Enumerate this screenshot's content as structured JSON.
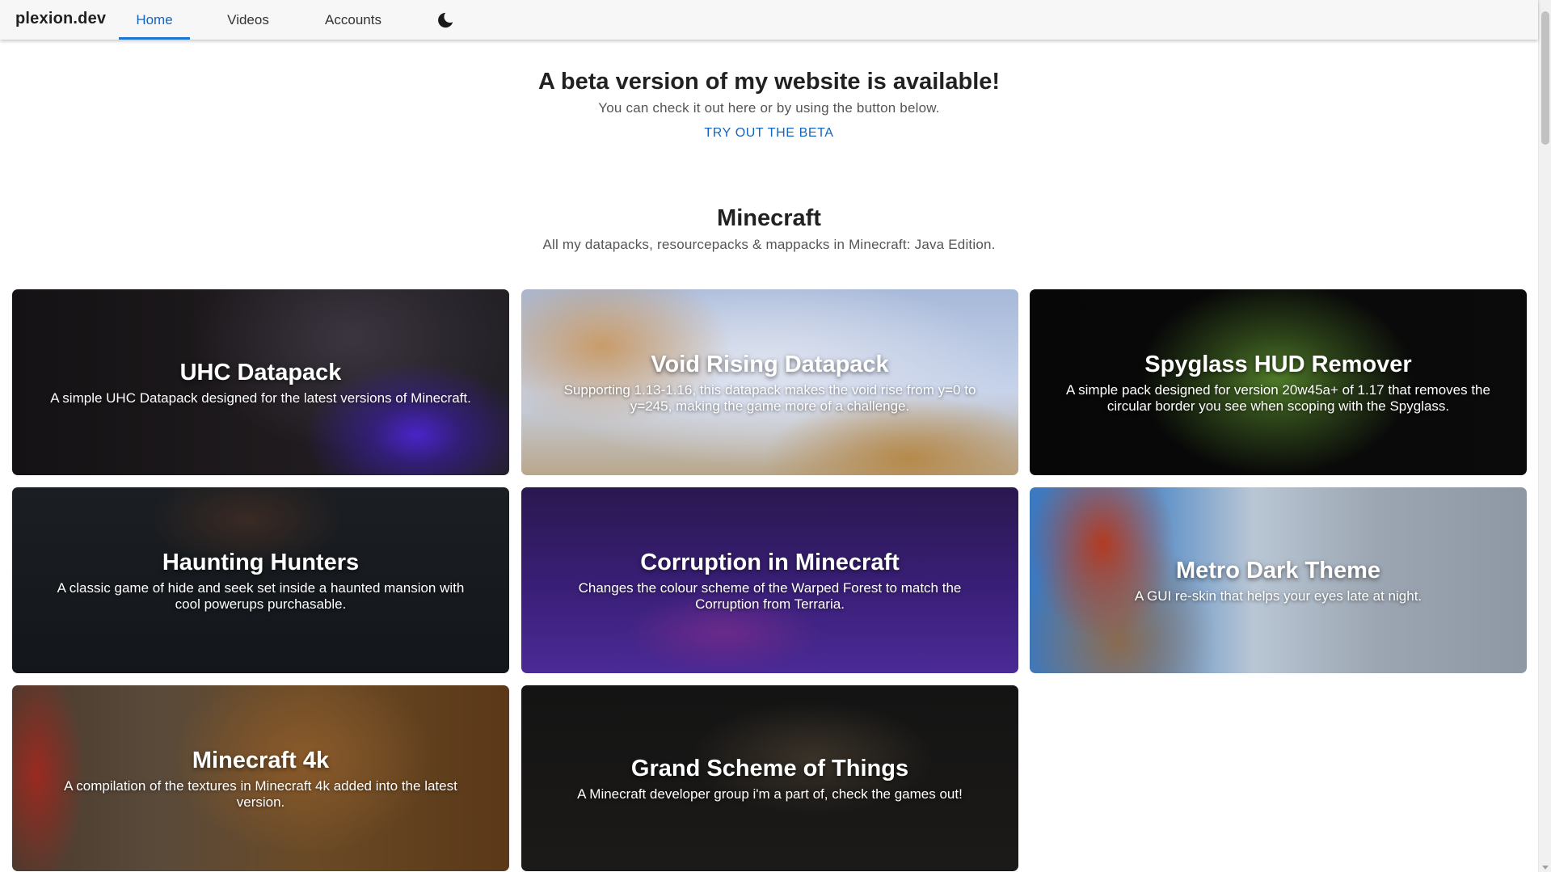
{
  "app": {
    "brand": "plexion.dev",
    "tabs": [
      {
        "label": "Home",
        "active": true
      },
      {
        "label": "Videos",
        "active": false
      },
      {
        "label": "Accounts",
        "active": false
      }
    ],
    "theme_toggle_icon": "moon-icon"
  },
  "beta": {
    "title": "A beta version of my website is available!",
    "subtitle": "You can check it out here or by using the button below.",
    "button": "TRY OUT THE BETA"
  },
  "section": {
    "title": "Minecraft",
    "subtitle": "All my datapacks, resourcepacks & mappacks in Minecraft: Java Edition."
  },
  "cards": [
    {
      "title": "UHC Datapack",
      "desc": "A simple UHC Datapack designed for the latest versions of Minecraft."
    },
    {
      "title": "Void Rising Datapack",
      "desc": "Supporting 1.13-1.16, this datapack makes the void rise from y=0 to y=245, making the game more of a challenge."
    },
    {
      "title": "Spyglass HUD Remover",
      "desc": "A simple pack designed for version 20w45a+ of 1.17 that removes the circular border you see when scoping with the Spyglass."
    },
    {
      "title": "Haunting Hunters",
      "desc": "A classic game of hide and seek set inside a haunted mansion with cool powerups purchasable."
    },
    {
      "title": "Corruption in Minecraft",
      "desc": "Changes the colour scheme of the Warped Forest to match the Corruption from Terraria."
    },
    {
      "title": "Metro Dark Theme",
      "desc": "A GUI re-skin that helps your eyes late at night."
    },
    {
      "title": "Minecraft 4k",
      "desc": "A compilation of the textures in Minecraft 4k added into the latest version."
    },
    {
      "title": "Grand Scheme of Things",
      "desc": "A Minecraft developer group i'm a part of, check the games out!"
    }
  ],
  "colors": {
    "accent": "#1976d2",
    "appbar_bg": "#f7f7f8"
  }
}
